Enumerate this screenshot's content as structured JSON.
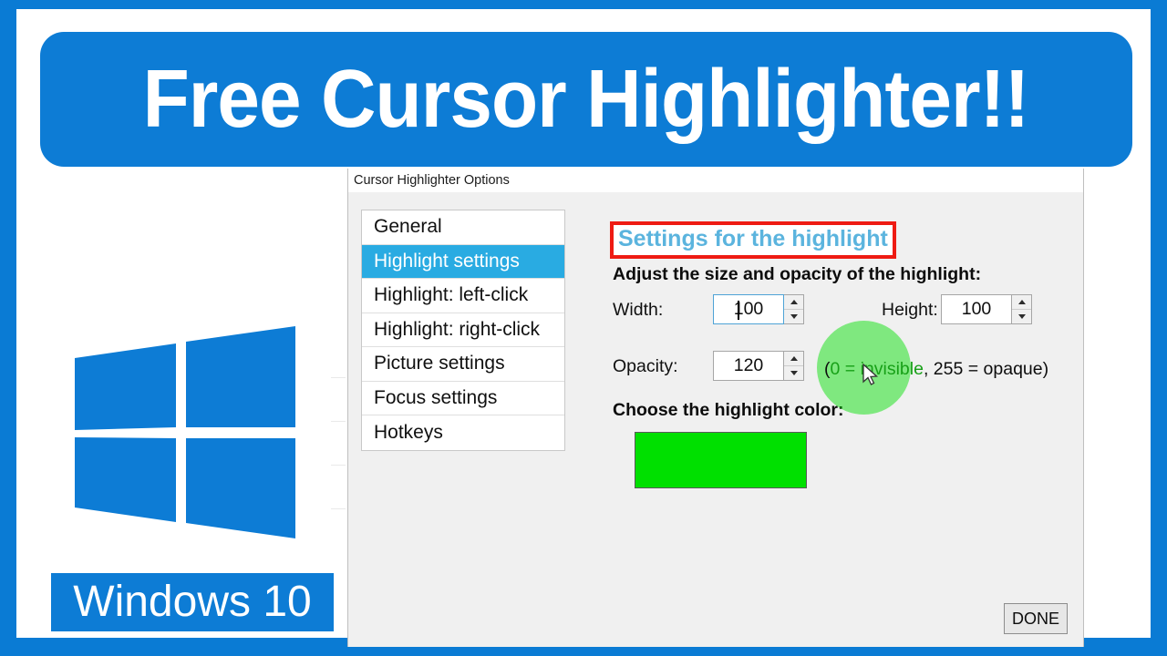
{
  "banner": {
    "title": "Free Cursor Highlighter!!",
    "background": "#0d7cd5"
  },
  "branding": {
    "os_label": "Windows 10",
    "logo_name": "windows-logo",
    "logo_color": "#0d7cd5"
  },
  "dialog": {
    "titlebar": "Cursor Highlighter Options",
    "sidebar": {
      "items": [
        {
          "label": "General",
          "selected": false
        },
        {
          "label": "Highlight settings",
          "selected": true
        },
        {
          "label": "Highlight: left-click",
          "selected": false
        },
        {
          "label": "Highlight: right-click",
          "selected": false
        },
        {
          "label": "Picture settings",
          "selected": false
        },
        {
          "label": "Focus settings",
          "selected": false
        },
        {
          "label": "Hotkeys",
          "selected": false
        }
      ],
      "selected_color": "#29abe2"
    },
    "pane": {
      "heading": "Settings for the highlight",
      "heading_color": "#5bb4de",
      "annotation_box_color": "#ee1b13",
      "subheading": "Adjust the size and opacity of the highlight:",
      "fields": {
        "width_label": "Width:",
        "width_value": "100",
        "height_label": "Height:",
        "height_value": "100",
        "opacity_label": "Opacity:",
        "opacity_value": "120"
      },
      "hint_prefix": "(",
      "hint_green": "0 = invisible",
      "hint_suffix": ", 255 = opaque)",
      "color_label": "Choose the highlight color:",
      "swatch_color": "#00e000",
      "highlight_circle_color": "rgba(0, 224, 0, 0.47)"
    },
    "done_label": "DONE"
  }
}
